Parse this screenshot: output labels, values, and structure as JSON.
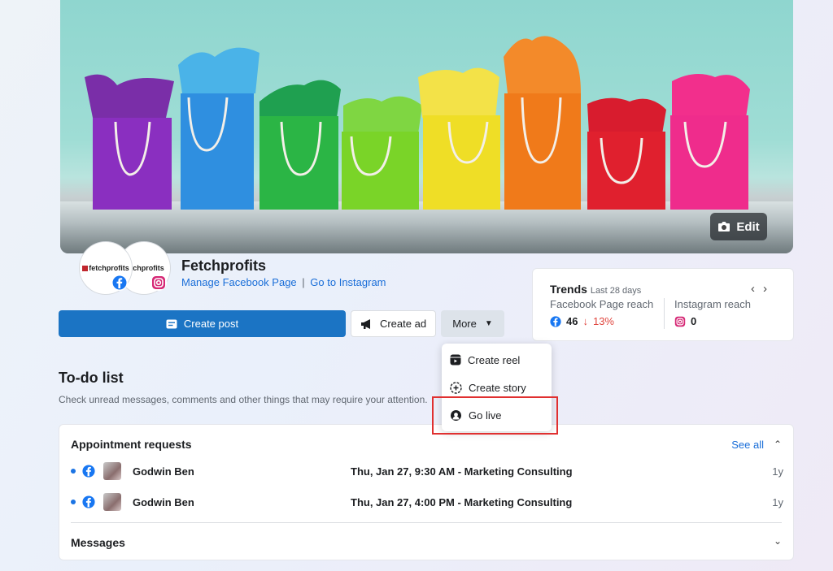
{
  "cover": {
    "edit_label": "Edit"
  },
  "profile": {
    "avatar_text": "fetchprofits",
    "name": "Fetchprofits",
    "manage_link": "Manage Facebook Page",
    "separator": "|",
    "instagram_link": "Go to Instagram"
  },
  "trends": {
    "title": "Trends",
    "period": "Last 28 days",
    "fb_label": "Facebook Page reach",
    "fb_value": "46",
    "fb_change": "13%",
    "ig_label": "Instagram reach",
    "ig_value": "0"
  },
  "actions": {
    "create_post": "Create post",
    "create_ad": "Create ad",
    "more": "More"
  },
  "dropdown": {
    "items": [
      {
        "label": "Create reel",
        "icon": "reel-icon"
      },
      {
        "label": "Create story",
        "icon": "story-plus-icon"
      },
      {
        "label": "Go live",
        "icon": "live-icon"
      }
    ]
  },
  "todo": {
    "title": "To-do list",
    "subtitle": "Check unread messages, comments and other things that may require your attention.",
    "appointments": {
      "title": "Appointment requests",
      "see_all": "See all",
      "rows": [
        {
          "name": "Godwin Ben",
          "detail": "Thu, Jan 27, 9:30 AM - Marketing Consulting",
          "age": "1y"
        },
        {
          "name": "Godwin Ben",
          "detail": "Thu, Jan 27, 4:00 PM - Marketing Consulting",
          "age": "1y"
        }
      ]
    },
    "messages": {
      "title": "Messages"
    }
  },
  "colors": {
    "brand_blue": "#1b74c4",
    "link_blue": "#1a6ed8",
    "down_red": "#e0463f",
    "highlight_red": "#e03030"
  }
}
